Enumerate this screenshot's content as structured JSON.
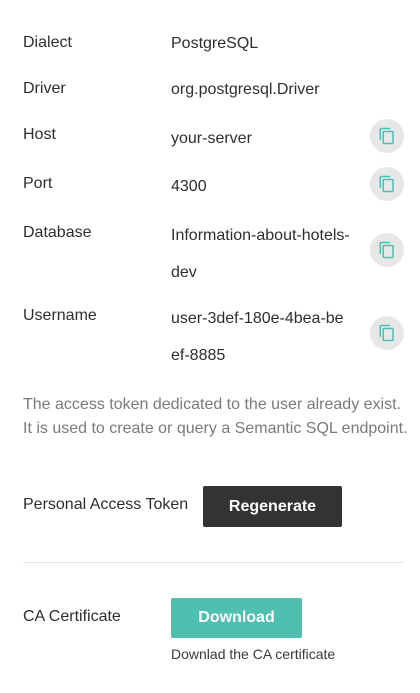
{
  "connection": {
    "dialect": {
      "label": "Dialect",
      "value": "PostgreSQL"
    },
    "driver": {
      "label": "Driver",
      "value": "org.postgresql.Driver"
    },
    "host": {
      "label": "Host",
      "value": "your-server"
    },
    "port": {
      "label": "Port",
      "value": "4300"
    },
    "database": {
      "label": "Database",
      "value": "Information-about-hotels-dev"
    },
    "username": {
      "label": "Username",
      "value": "user-3def-180e-4bea-beef-8885"
    }
  },
  "copy_icon": "copy-icon",
  "note": "The access token dedicated to the user already exist. It is used to create or query a Semantic SQL endpoint.",
  "token": {
    "label": "Personal Access Token",
    "button_label": "Regenerate"
  },
  "ca": {
    "label": "CA Certificate",
    "button_label": "Download",
    "hint": "Downlad the CA certificate"
  },
  "colors": {
    "accent": "#4fbfb0",
    "dark_button": "#333333",
    "copy_button_bg": "#e7e7e7"
  }
}
